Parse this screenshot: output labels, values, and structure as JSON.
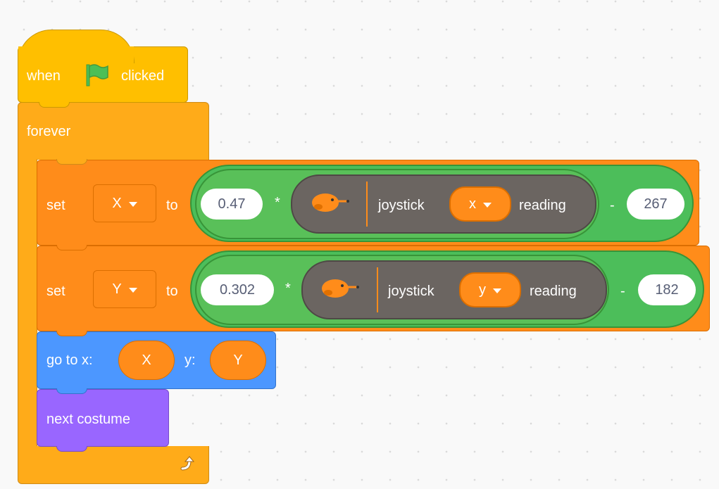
{
  "script": {
    "hat": {
      "before": "when",
      "after": "clicked",
      "flag_icon": "green-flag-icon"
    },
    "forever": {
      "label": "forever",
      "loop_icon": "loop-arrow-icon"
    },
    "set_x": {
      "set": "set",
      "variable": "X",
      "to": "to",
      "factor": "0.47",
      "mult": "*",
      "sensor_label": "joystick",
      "axis": "x",
      "reading": "reading",
      "minus": "-",
      "offset": "267"
    },
    "set_y": {
      "set": "set",
      "variable": "Y",
      "to": "to",
      "factor": "0.302",
      "mult": "*",
      "sensor_label": "joystick",
      "axis": "y",
      "reading": "reading",
      "minus": "-",
      "offset": "182"
    },
    "goto": {
      "label": "go to x:",
      "x_value": "X",
      "y_label": "y:",
      "y_value": "Y"
    },
    "costume": {
      "label": "next costume"
    }
  },
  "colors": {
    "events": "#ffbf00",
    "control": "#ffab19",
    "variables": "#ff8c1a",
    "operators": "#59c059",
    "motion": "#4c97ff",
    "looks": "#9966ff",
    "sensor": "#6b6561"
  }
}
